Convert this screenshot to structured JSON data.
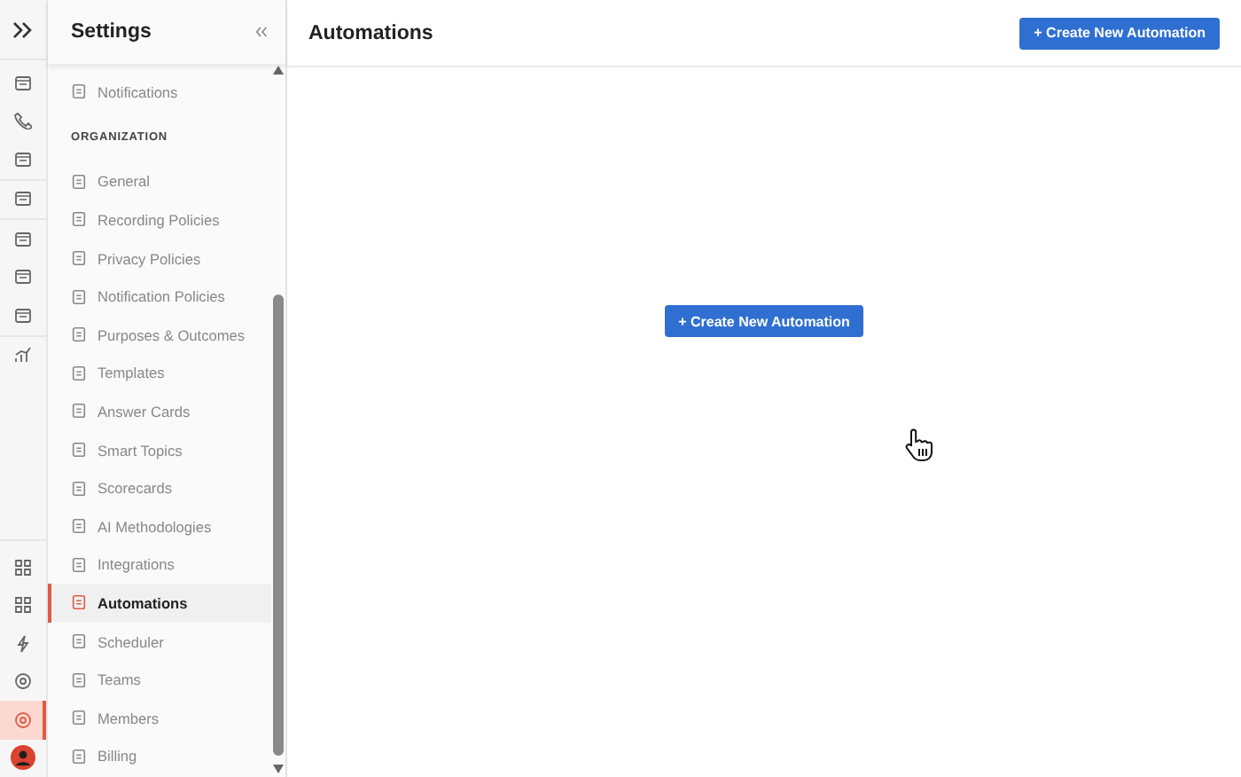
{
  "page_title": "Automations",
  "header_button": "+ Create New Automation",
  "empty_state_button": "+ Create New Automation",
  "rail": {
    "top_items": [
      {
        "selected": false
      },
      {
        "selected": false
      },
      {
        "selected": false
      },
      {
        "selected": false
      },
      {
        "selected": false
      },
      {
        "selected": false
      },
      {
        "selected": false
      },
      {
        "selected": false
      }
    ],
    "bottom_items": [
      {
        "selected": false
      },
      {
        "selected": false
      },
      {
        "selected": false
      },
      {
        "selected": false
      },
      {
        "selected": true
      }
    ]
  },
  "sidebar": {
    "title": "Settings",
    "items": [
      {
        "kind": "item",
        "label": "Notifications",
        "selected": false
      },
      {
        "kind": "section",
        "label": "ORGANIZATION"
      },
      {
        "kind": "item",
        "label": "General",
        "selected": false
      },
      {
        "kind": "item",
        "label": "Recording Policies",
        "selected": false
      },
      {
        "kind": "item",
        "label": "Privacy Policies",
        "selected": false
      },
      {
        "kind": "item",
        "label": "Notification Policies",
        "selected": false
      },
      {
        "kind": "item",
        "label": "Purposes & Outcomes",
        "selected": false
      },
      {
        "kind": "item",
        "label": "Templates",
        "selected": false
      },
      {
        "kind": "item",
        "label": "Answer Cards",
        "selected": false
      },
      {
        "kind": "item",
        "label": "Smart Topics",
        "selected": false
      },
      {
        "kind": "item",
        "label": "Scorecards",
        "selected": false
      },
      {
        "kind": "item",
        "label": "AI Methodologies",
        "selected": false
      },
      {
        "kind": "item",
        "label": "Integrations",
        "selected": false
      },
      {
        "kind": "item",
        "label": "Automations",
        "selected": true
      },
      {
        "kind": "item",
        "label": "Scheduler",
        "selected": false
      },
      {
        "kind": "item",
        "label": "Teams",
        "selected": false
      },
      {
        "kind": "item",
        "label": "Members",
        "selected": false
      },
      {
        "kind": "item",
        "label": "Billing",
        "selected": false
      }
    ]
  }
}
